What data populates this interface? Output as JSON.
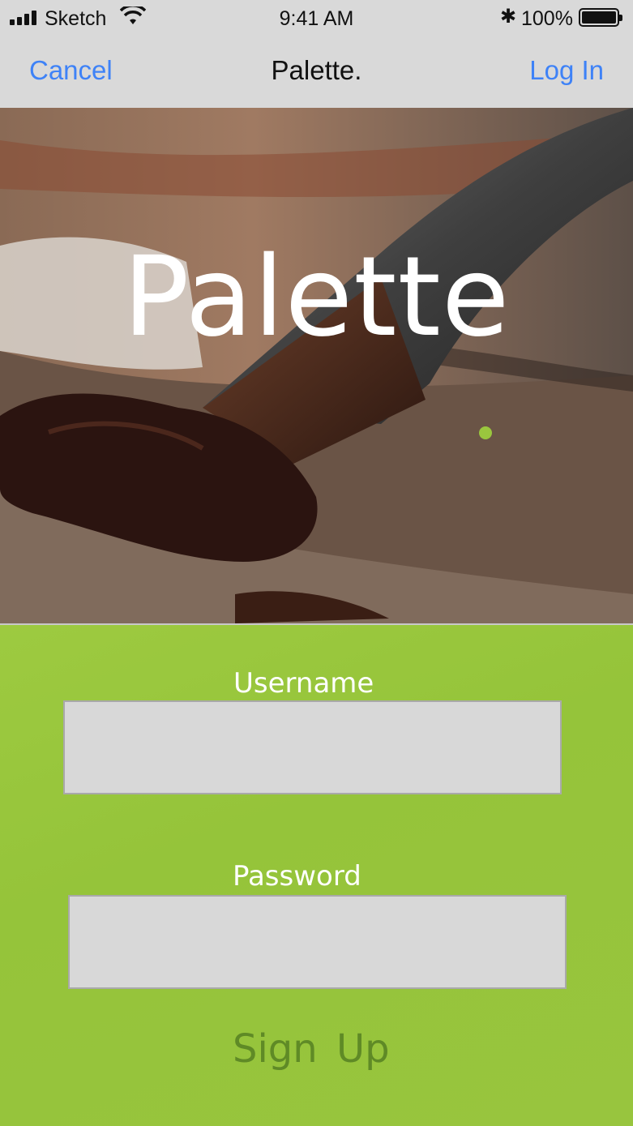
{
  "status_bar": {
    "carrier": "Sketch",
    "time": "9:41 AM",
    "battery_percent": "100%",
    "icons": [
      "signal-icon",
      "wifi-icon",
      "bluetooth-icon",
      "battery-icon"
    ]
  },
  "nav": {
    "left_label": "Cancel",
    "title": "Palette.",
    "right_label": "Log In",
    "accent_color": "#3e82f7"
  },
  "hero": {
    "title": "Palette",
    "dot_color": "#9ac63e"
  },
  "form": {
    "username_label": "Username",
    "username_value": "",
    "password_label": "Password",
    "password_value": "",
    "submit_label": "Sign  Up",
    "background_color": "#9ac63e"
  }
}
